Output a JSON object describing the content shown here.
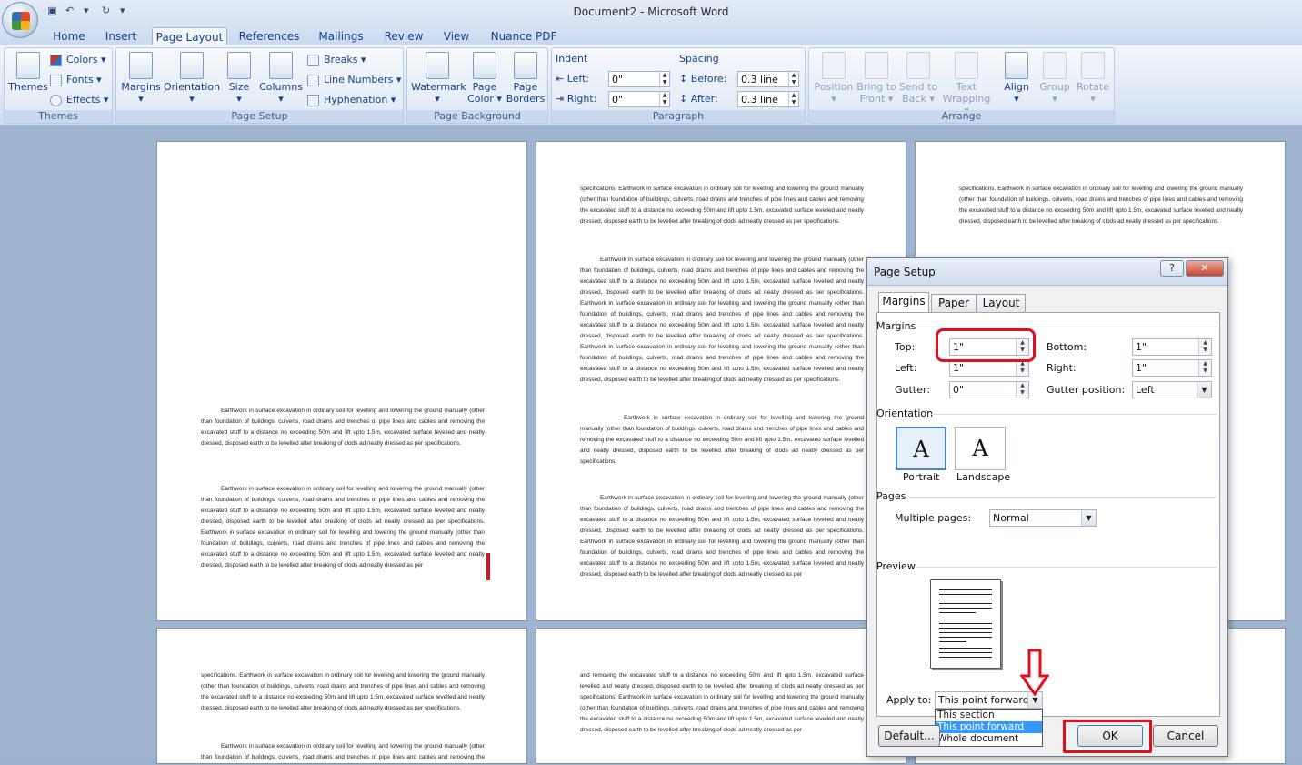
{
  "window": {
    "title": "Document2 - Microsoft Word"
  },
  "tabs": [
    "Home",
    "Insert",
    "Page Layout",
    "References",
    "Mailings",
    "Review",
    "View",
    "Nuance PDF"
  ],
  "ribbon": {
    "themes": {
      "themes_label": "Themes",
      "colors": "Colors",
      "fonts": "Fonts",
      "effects": "Effects",
      "group": "Themes"
    },
    "page_setup": {
      "margins": "Margins",
      "orientation": "Orientation",
      "size": "Size",
      "columns": "Columns",
      "breaks": "Breaks",
      "line_numbers": "Line Numbers",
      "hyphenation": "Hyphenation",
      "group": "Page Setup"
    },
    "page_background": {
      "watermark": "Watermark",
      "page_color_1": "Page",
      "page_color_2": "Color",
      "page_borders_1": "Page",
      "page_borders_2": "Borders",
      "group": "Page Background"
    },
    "paragraph": {
      "indent": "Indent",
      "left": "Left:",
      "left_val": "0\"",
      "right": "Right:",
      "right_val": "0\"",
      "spacing": "Spacing",
      "before": "Before:",
      "before_val": "0.3 line",
      "after": "After:",
      "after_val": "0.3 line",
      "group": "Paragraph"
    },
    "arrange": {
      "position": "Position",
      "bring_1": "Bring to",
      "bring_2": "Front",
      "send_1": "Send to",
      "send_2": "Back",
      "text_1": "Text",
      "text_2": "Wrapping",
      "align": "Align",
      "group_btn": "Group",
      "rotate": "Rotate",
      "group": "Arrange"
    }
  },
  "document": {
    "para_a": "Earthwork in surface excavation in ordinary soil for levelling and lowering the ground manually (other than foundation of buildings, culverts, road drains and trenches of pipe lines and cables and removing the excavated stuff to a distance no exceeding 50m and lift upto 1.5m, excavated surface levelled and neatly dressed, disposed earth to be levelled after breaking of clods ad neatly dressed as per specifications.",
    "para_b": "Earthwork in surface excavation in ordinary soil for levelling and lowering the ground manually (other than foundation of buildings, culverts, road drains and trenches of pipe lines and cables and removing the excavated stuff to a distance no exceeding 50m and lift upto 1.5m, excavated surface levelled and neatly dressed, disposed earth to be levelled after breaking of clods ad neatly dressed as per specifications. Earthwork in surface excavation in ordinary soil for levelling and lowering the ground manually (other than foundation of buildings, culverts, road drains and trenches of pipe lines and cables and removing the excavated stuff to a distance no exceeding 50m and lift upto 1.5m, excavated surface levelled and neatly dressed, disposed earth to be levelled after breaking of clods ad neatly dressed as per",
    "para_c": "specifications. Earthwork in surface excavation in ordinary soil for levelling and lowering the ground manually (other than foundation of buildings, culverts, road drains and trenches of pipe lines and cables and removing the excavated stuff to a distance no exceeding 50m and lift upto 1.5m, excavated surface levelled and neatly dressed, disposed earth to be levelled after breaking of clods ad neatly dressed as per specifications.",
    "para_d": "Earthwork in surface excavation in ordinary soil for levelling and lowering the ground manually (other than foundation of buildings, culverts, road drains and trenches of pipe lines and cables and removing the excavated stuff to a distance no exceeding 50m and lift upto 1.5m, excavated surface levelled and neatly dressed, disposed earth to be levelled after breaking of clods ad neatly dressed as per specifications. Earthwork in surface excavation in ordinary soil for levelling and lowering the ground manually (other than foundation of buildings, culverts, road drains and trenches of pipe lines and cables and removing the excavated stuff to a distance no exceeding 50m and lift upto 1.5m, excavated surface levelled and neatly dressed, disposed earth to be levelled after breaking of clods ad neatly dressed as per specifications. Earthwork in surface excavation in ordinary soil for levelling and lowering the ground manually (other than foundation of buildings, culverts, road drains and trenches of pipe lines and cables and removing the excavated stuff to a distance no exceeding 50m and lift upto 1.5m, excavated surface levelled and neatly dressed, disposed earth to be levelled after breaking of clods ad neatly dressed as per specifications.",
    "para_e": "and removing the excavated stuff to a distance no exceeding 50m and lift upto 1.5m, excavated surface levelled and neatly dressed, disposed earth to be levelled after breaking of clods ad neatly dressed as per specifications. Earthwork in surface excavation in ordinary soil for levelling and lowering the ground manually (other than foundation of buildings, culverts, road drains and trenches of pipe lines and cables and removing the excavated stuff to a distance no exceeding 50m and lift upto 1.5m, excavated surface levelled and neatly dressed, disposed earth to be levelled after breaking of clods ad neatly dressed as per"
  },
  "dialog": {
    "title": "Page Setup",
    "help": "?",
    "close": "✕",
    "tabs": {
      "margins": "Margins",
      "paper": "Paper",
      "layout": "Layout"
    },
    "margins_section": "Margins",
    "top_label": "Top:",
    "top_val": "1\"",
    "bottom_label": "Bottom:",
    "bottom_val": "1\"",
    "left_label": "Left:",
    "left_val": "1\"",
    "right_label": "Right:",
    "right_val": "1\"",
    "gutter_label": "Gutter:",
    "gutter_val": "0\"",
    "gutter_pos_label": "Gutter position:",
    "gutter_pos_val": "Left",
    "orientation_section": "Orientation",
    "portrait": "Portrait",
    "landscape": "Landscape",
    "pages_section": "Pages",
    "multiple_pages_label": "Multiple pages:",
    "multiple_pages_val": "Normal",
    "preview_section": "Preview",
    "apply_to_label": "Apply to:",
    "apply_to_val": "This point forward",
    "apply_options": [
      "This section",
      "This point forward",
      "Whole document"
    ],
    "default_btn": "Default...",
    "ok_btn": "OK",
    "cancel_btn": "Cancel"
  },
  "annotation_color": "#e0101c"
}
